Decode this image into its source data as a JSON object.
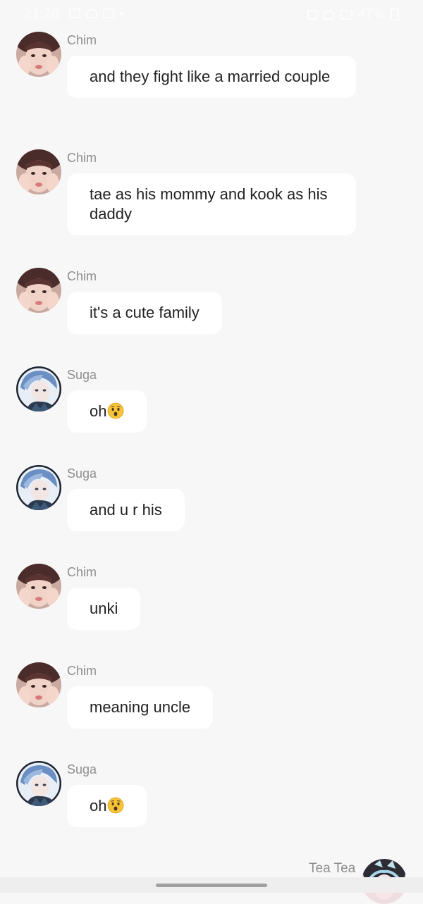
{
  "status_bar": {
    "time": "21:28",
    "battery": "47%"
  },
  "messages": [
    {
      "sender": "Chim",
      "text": "and they fight like a married couple",
      "avatar": "chim-avatar"
    },
    {
      "sender": "Chim",
      "text": "tae as his mommy and kook as his daddy",
      "avatar": "chim-avatar"
    },
    {
      "sender": "Chim",
      "text": "it's a cute family",
      "avatar": "chim-avatar"
    },
    {
      "sender": "Suga",
      "text": "oh",
      "emoji": "hushed-face",
      "avatar": "suga-avatar"
    },
    {
      "sender": "Suga",
      "text": "and u r his",
      "avatar": "suga-avatar"
    },
    {
      "sender": "Chim",
      "text": "unki",
      "avatar": "chim-avatar"
    },
    {
      "sender": "Chim",
      "text": "meaning uncle",
      "avatar": "chim-avatar"
    },
    {
      "sender": "Suga",
      "text": "oh",
      "emoji": "hushed-face",
      "avatar": "suga-avatar"
    }
  ],
  "outgoing": {
    "sender": "Tea Tea",
    "avatar": "tea-tea-avatar"
  },
  "colors": {
    "background": "#f7f7f7",
    "bubble": "#ffffff",
    "sender_name": "#8e8e8e",
    "message_text": "#222222"
  }
}
